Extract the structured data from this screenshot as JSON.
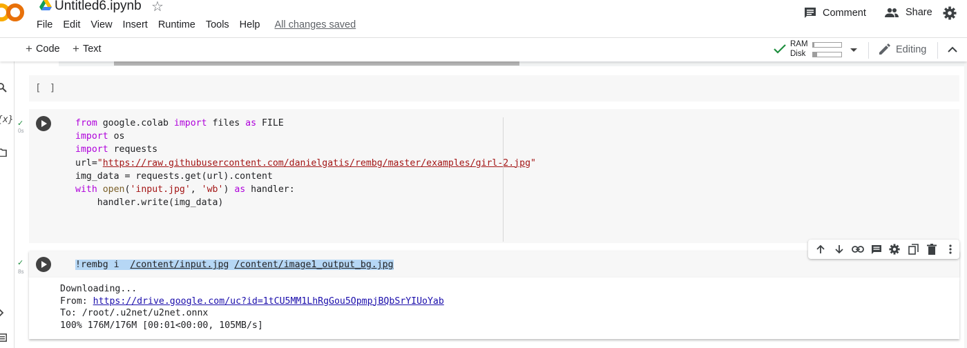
{
  "header": {
    "logo_text": "CO",
    "doc_title": "Untitled6.ipynb",
    "menu": [
      "File",
      "Edit",
      "View",
      "Insert",
      "Runtime",
      "Tools",
      "Help"
    ],
    "save_status": "All changes saved",
    "comment_label": "Comment",
    "share_label": "Share"
  },
  "toolbar": {
    "code_label": "Code",
    "text_label": "Text",
    "ram_label": "RAM",
    "disk_label": "Disk",
    "ram_usage": 0.05,
    "disk_usage": 0.15,
    "editing_label": "Editing"
  },
  "rail": {
    "variables_label": "{x}"
  },
  "cells": {
    "empty_cell_brackets": "[ ]",
    "cell1": {
      "status_icon": "check-icon",
      "exec_time": "0s",
      "lines": [
        [
          [
            "kw",
            "from"
          ],
          [
            "",
            " google.colab "
          ],
          [
            "kw",
            "import"
          ],
          [
            "",
            " files "
          ],
          [
            "kw",
            "as"
          ],
          [
            "",
            " FILE"
          ]
        ],
        [
          [
            "kw",
            "import"
          ],
          [
            "",
            " os"
          ]
        ],
        [
          [
            "kw",
            "import"
          ],
          [
            "",
            " requests"
          ]
        ],
        [
          [
            "",
            "url="
          ],
          [
            "str",
            "\""
          ],
          [
            "url",
            "https://raw.githubusercontent.com/danielgatis/rembg/master/examples/girl-2.jpg"
          ],
          [
            "str",
            "\""
          ]
        ],
        [
          [
            "",
            "img_data = requests.get(url).content"
          ]
        ],
        [
          [
            "kw2",
            "with"
          ],
          [
            "",
            " "
          ],
          [
            "kw3",
            "open"
          ],
          [
            "",
            "("
          ],
          [
            "str",
            "'input.jpg'"
          ],
          [
            "",
            ", "
          ],
          [
            "str",
            "'wb'"
          ],
          [
            "",
            ") "
          ],
          [
            "kw2",
            "as"
          ],
          [
            "",
            " handler:"
          ]
        ],
        [
          [
            "",
            "    handler.write(img_data)"
          ]
        ]
      ]
    },
    "cell2": {
      "status_icon": "check-icon",
      "exec_time": "8s",
      "command": [
        [
          "sel",
          "!rembg i  "
        ],
        [
          "sel-u",
          "/content/input.jpg"
        ],
        [
          "sel",
          " "
        ],
        [
          "sel-u",
          "/content/image1_output_bg.jpg"
        ]
      ],
      "output": [
        [
          [
            "",
            "Downloading..."
          ]
        ],
        [
          [
            "",
            "From: "
          ],
          [
            "link",
            "https://drive.google.com/uc?id=1tCU5MM1LhRgGou5OpmpjBQbSrYIUoYab"
          ]
        ],
        [
          [
            "",
            "To: /root/.u2net/u2net.onnx"
          ]
        ],
        [
          [
            "",
            "100% 176M/176M [00:01<00:00, 105MB/s]"
          ]
        ]
      ]
    }
  },
  "colors": {
    "accent_orange": "#f9ab00",
    "keyword": "#af00db",
    "string": "#a31515",
    "link": "#1a0dab",
    "success_green": "#1e8e3e"
  }
}
